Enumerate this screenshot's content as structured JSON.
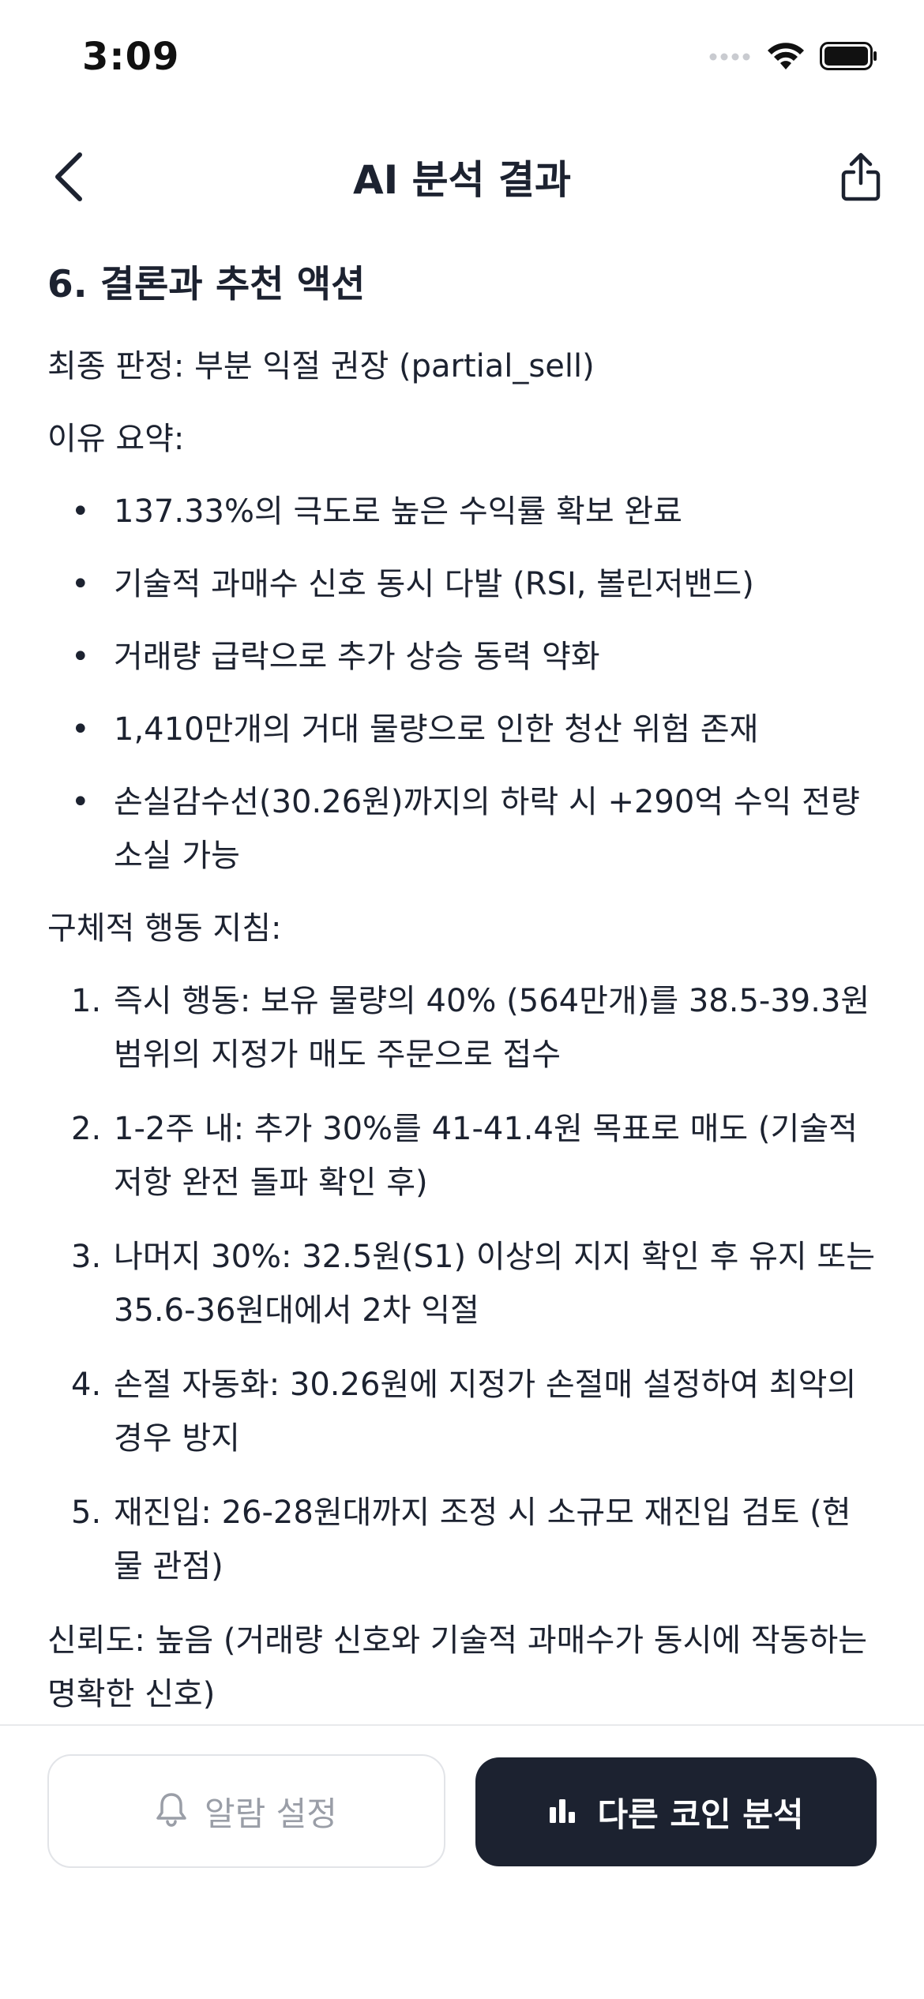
{
  "status_bar": {
    "time": "3:09"
  },
  "header": {
    "title": "AI 분석 결과",
    "back_icon": "chevron-left-icon",
    "share_icon": "share-icon"
  },
  "content": {
    "section_heading": "6. 결론과 추천 액션",
    "final_verdict": "최종 판정: 부분 익절 권장 (partial_sell)",
    "reason_label": "이유 요약:",
    "reasons": [
      "137.33%의 극도로 높은 수익률 확보 완료",
      "기술적 과매수 신호 동시 다발 (RSI, 볼린저밴드)",
      "거래량 급락으로 추가 상승 동력 약화",
      "1,410만개의 거대 물량으로 인한 청산 위험 존재",
      "손실감수선(30.26원)까지의 하락 시 +290억 수익 전량 소실 가능"
    ],
    "action_label": "구체적 행동 지침:",
    "actions": [
      {
        "num": "1.",
        "text": "즉시 행동: 보유 물량의 40% (564만개)를 38.5-39.3원 범위의 지정가 매도 주문으로 접수"
      },
      {
        "num": "2.",
        "text": "1-2주 내: 추가 30%를 41-41.4원 목표로 매도 (기술적 저항 완전 돌파 확인 후)"
      },
      {
        "num": "3.",
        "text": "나머지 30%: 32.5원(S1) 이상의 지지 확인 후 유지 또는 35.6-36원대에서 2차 익절"
      },
      {
        "num": "4.",
        "text": "손절 자동화: 30.26원에 지정가 손절매 설정하여 최악의 경우 방지"
      },
      {
        "num": "5.",
        "text": "재진입: 26-28원대까지 조정 시 소규모 재진입 검토 (현물 관점)"
      }
    ],
    "confidence": "신뢰도: 높음 (거래량 신호와 기술적 과매수가 동시에 작동하는 명확한 신호)"
  },
  "bottom_bar": {
    "alarm_button_label": "알람 설정",
    "alarm_icon": "bell-icon",
    "analyze_button_label": "다른 코인 분석",
    "analyze_icon": "bar-chart-icon"
  },
  "colors": {
    "primary_dark": "#1c2230",
    "muted_text": "#9a9ea7",
    "border": "#e2e4e8"
  }
}
